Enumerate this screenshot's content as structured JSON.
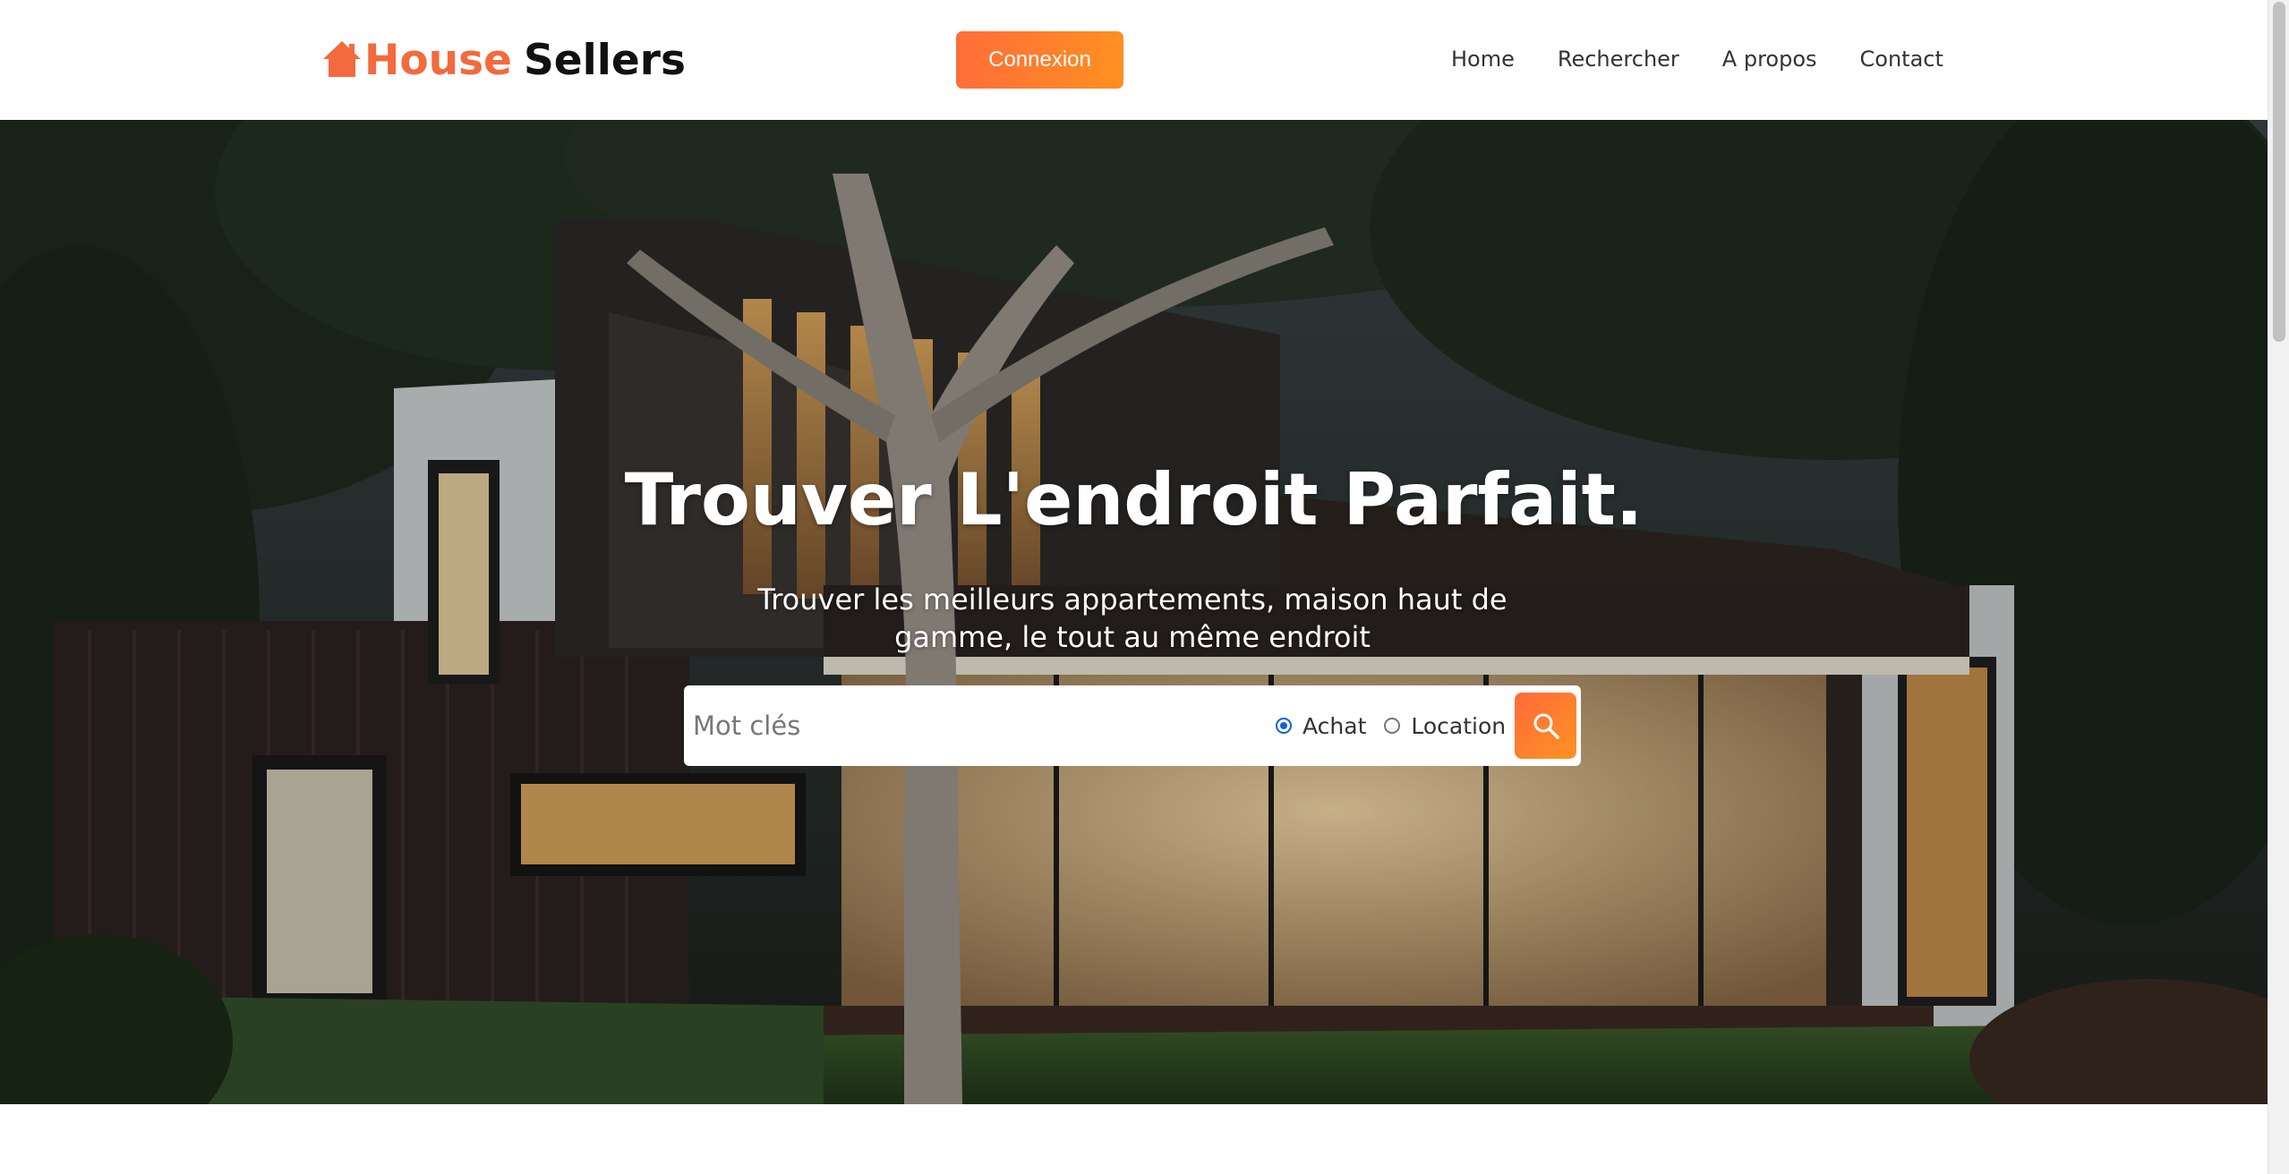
{
  "header": {
    "logo": {
      "part1": "House",
      "part2": "Sellers",
      "icon": "house-icon"
    },
    "connexion_label": "Connexion",
    "nav": [
      {
        "label": "Home"
      },
      {
        "label": "Rechercher"
      },
      {
        "label": "A propos"
      },
      {
        "label": "Contact"
      }
    ]
  },
  "hero": {
    "title": "Trouver L'endroit Parfait.",
    "subtitle": "Trouver les meilleurs appartements, maison haut de gamme, le tout au même endroit",
    "search": {
      "placeholder": "Mot clés",
      "value": "",
      "options": [
        {
          "label": "Achat",
          "checked": true
        },
        {
          "label": "Location",
          "checked": false
        }
      ],
      "button_icon": "search-icon"
    }
  },
  "colors": {
    "brand": "#f26a3d",
    "button_gradient_start": "#ff6d38",
    "button_gradient_end": "#ff9021",
    "radio_checked": "#0b63d6"
  }
}
